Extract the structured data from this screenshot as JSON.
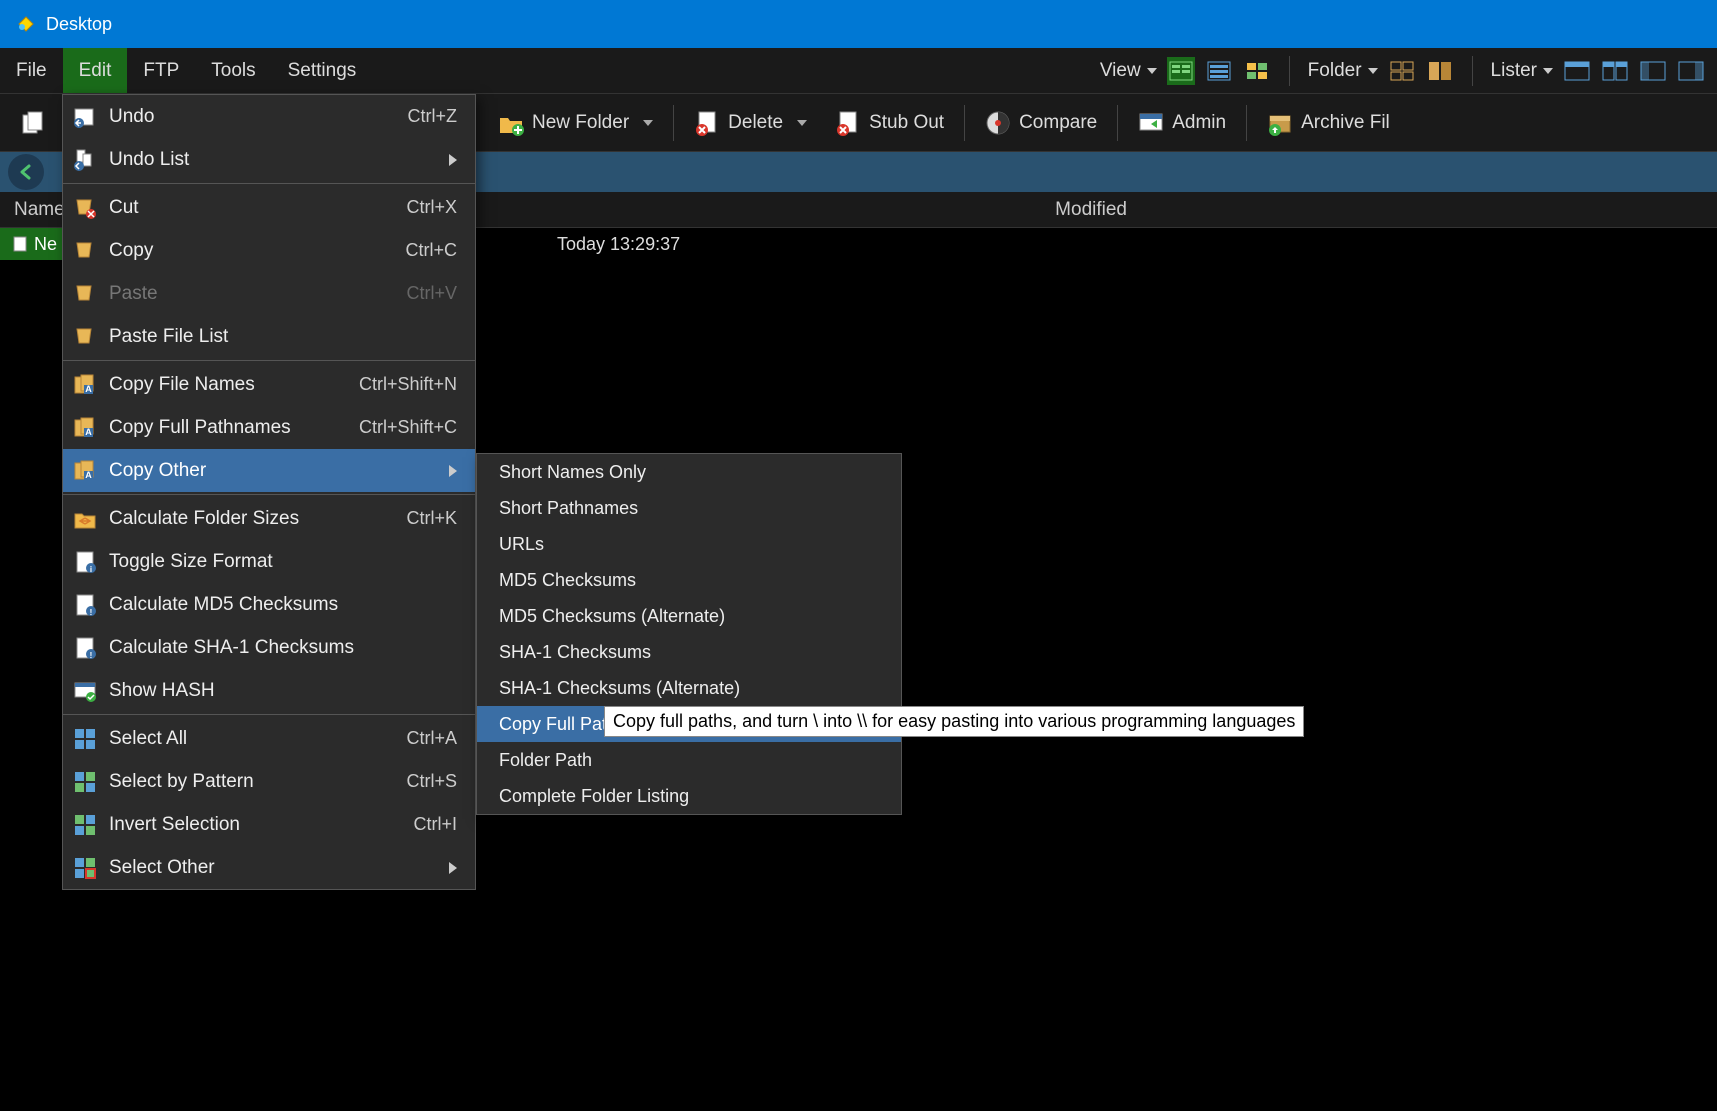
{
  "titlebar": {
    "title": "Desktop"
  },
  "menubar": {
    "items": [
      "File",
      "Edit",
      "FTP",
      "Tools",
      "Settings"
    ],
    "view_label": "View",
    "folder_label": "Folder",
    "lister_label": "Lister"
  },
  "toolbar": {
    "new_folder": "New Folder",
    "delete": "Delete",
    "stub_out": "Stub Out",
    "compare": "Compare",
    "admin": "Admin",
    "archive_files": "Archive Fil"
  },
  "columns": {
    "name": "Name",
    "modified": "Modified"
  },
  "files": [
    {
      "name_partial": "Ne",
      "modified": "Today  13:29:37"
    }
  ],
  "edit_menu": {
    "items": [
      {
        "label": "Undo",
        "shortcut": "Ctrl+Z",
        "icon": "undo"
      },
      {
        "label": "Undo List",
        "submenu": true,
        "icon": "undo-list"
      },
      {
        "sep": true
      },
      {
        "label": "Cut",
        "shortcut": "Ctrl+X",
        "icon": "cut"
      },
      {
        "label": "Copy",
        "shortcut": "Ctrl+C",
        "icon": "copy"
      },
      {
        "label": "Paste",
        "shortcut": "Ctrl+V",
        "icon": "paste",
        "disabled": true
      },
      {
        "label": "Paste File List",
        "icon": "paste"
      },
      {
        "sep": true
      },
      {
        "label": "Copy File Names",
        "shortcut": "Ctrl+Shift+N",
        "icon": "copy-name"
      },
      {
        "label": "Copy Full Pathnames",
        "shortcut": "Ctrl+Shift+C",
        "icon": "copy-name"
      },
      {
        "label": "Copy Other",
        "submenu": true,
        "icon": "copy-name",
        "highlight": true
      },
      {
        "sep": true
      },
      {
        "label": "Calculate Folder Sizes",
        "shortcut": "Ctrl+K",
        "icon": "folder-size"
      },
      {
        "label": "Toggle Size Format",
        "icon": "doc-info"
      },
      {
        "label": "Calculate MD5 Checksums",
        "icon": "doc-check"
      },
      {
        "label": "Calculate SHA-1 Checksums",
        "icon": "doc-check"
      },
      {
        "label": "Show HASH",
        "icon": "hash"
      },
      {
        "sep": true
      },
      {
        "label": "Select All",
        "shortcut": "Ctrl+A",
        "icon": "select-all"
      },
      {
        "label": "Select by Pattern",
        "shortcut": "Ctrl+S",
        "icon": "select-pattern"
      },
      {
        "label": "Invert Selection",
        "shortcut": "Ctrl+I",
        "icon": "select-invert"
      },
      {
        "label": "Select Other",
        "submenu": true,
        "icon": "select-other"
      }
    ]
  },
  "copy_other_submenu": {
    "items": [
      "Short Names Only",
      "Short Pathnames",
      "URLs",
      "MD5 Checksums",
      "MD5 Checksums (Alternate)",
      "SHA-1 Checksums",
      "SHA-1 Checksums (Alternate)",
      "Copy Full Pathnames (Double Backslashes)",
      "Folder Path",
      "Complete Folder Listing"
    ],
    "highlight_index": 7
  },
  "tooltip": "Copy full paths, and turn \\ into \\\\ for easy pasting into various programming languages"
}
